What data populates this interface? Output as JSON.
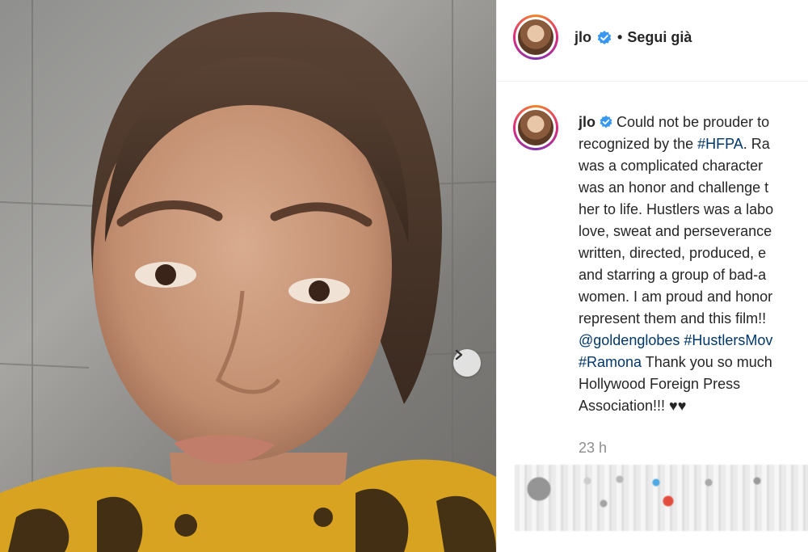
{
  "header": {
    "username": "jlo",
    "separator": "•",
    "follow_label": "Segui già"
  },
  "caption": {
    "username": "jlo",
    "lines": [
      "Could not be prouder to",
      "recognized by the",
      "#HFPA",
      ". Ra",
      "was a complicated character",
      "was an honor and challenge t",
      "her to life. Hustlers was a labo",
      "love, sweat and perseverance",
      "written, directed, produced, e",
      "and starring a group of bad-a",
      "women. I am proud and honor",
      "represent them and this film!!",
      "@goldenglobes #HustlersMov",
      "#Ramona",
      " Thank you so much",
      "Hollywood Foreign Press",
      "Association!!! ♥♥"
    ]
  },
  "timestamp": "23 h",
  "icons": {
    "verified": "verified-badge-icon",
    "next": "chevron-right-icon"
  },
  "colors": {
    "verified": "#3897f0",
    "hashtag": "#00376b",
    "timestamp": "#8e8e8e"
  }
}
